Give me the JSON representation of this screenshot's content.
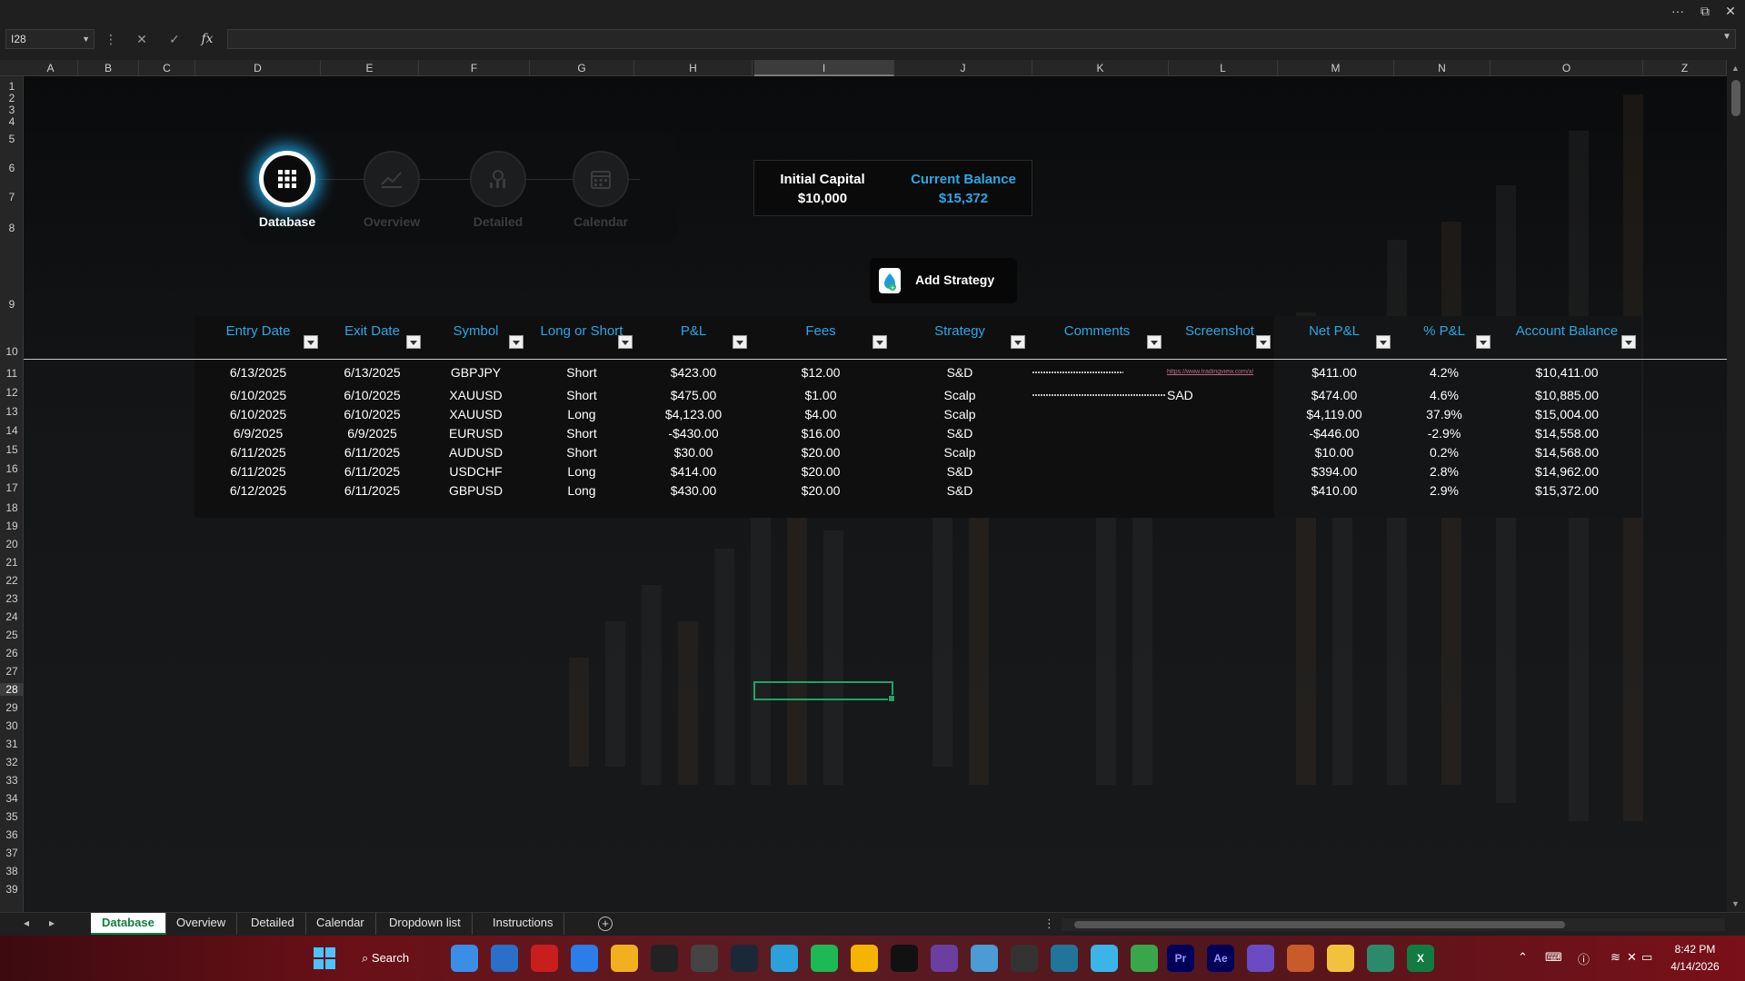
{
  "window": {
    "more": "···",
    "restore": "⧉",
    "close": "✕"
  },
  "formula_bar": {
    "name_box": "I28",
    "cancel": "✕",
    "enter": "✓",
    "fx": "fx",
    "more": "⋮"
  },
  "columns": [
    "A",
    "B",
    "C",
    "D",
    "E",
    "F",
    "G",
    "H",
    "I",
    "J",
    "K",
    "L",
    "M",
    "N",
    "O",
    "Z"
  ],
  "rows": [
    "1",
    "2",
    "3",
    "4",
    "5",
    "6",
    "7",
    "8",
    "9",
    "10",
    "11",
    "12",
    "13",
    "14",
    "15",
    "16",
    "17",
    "18",
    "19",
    "20",
    "21",
    "22",
    "23",
    "24",
    "25",
    "26",
    "27",
    "28",
    "29",
    "30",
    "31",
    "32",
    "33",
    "34",
    "35",
    "36",
    "37",
    "38",
    "39"
  ],
  "nav": [
    {
      "label": "Database",
      "icon": "grid-icon"
    },
    {
      "label": "Overview",
      "icon": "chart-icon"
    },
    {
      "label": "Detailed",
      "icon": "detail-chart-icon"
    },
    {
      "label": "Calendar",
      "icon": "calendar-icon"
    }
  ],
  "capital": {
    "initial_label": "Initial Capital",
    "initial_value": "$10,000",
    "current_label": "Current Balance",
    "current_value": "$15,372"
  },
  "add_strategy": {
    "label": "Add Strategy"
  },
  "table": {
    "headers": [
      "Entry Date",
      "Exit Date",
      "Symbol",
      "Long or Short",
      "P&L",
      "Fees",
      "Strategy",
      "Comments",
      "Screenshot",
      "Net P&L",
      "% P&L",
      "Account Balance"
    ],
    "rows": [
      [
        "6/13/2025",
        "6/13/2025",
        "GBPJPY",
        "Short",
        "$423.00",
        "$12.00",
        "S&D",
        "",
        "https://www.tradingview.com/x/",
        "$411.00",
        "4.2%",
        "$10,411.00"
      ],
      [
        "6/10/2025",
        "6/10/2025",
        "XAUUSD",
        "Short",
        "$475.00",
        "$1.00",
        "Scalp",
        "",
        "SAD",
        "$474.00",
        "4.6%",
        "$10,885.00"
      ],
      [
        "6/10/2025",
        "6/10/2025",
        "XAUUSD",
        "Long",
        "$4,123.00",
        "$4.00",
        "Scalp",
        "",
        "",
        "$4,119.00",
        "37.9%",
        "$15,004.00"
      ],
      [
        "6/9/2025",
        "6/9/2025",
        "EURUSD",
        "Short",
        "-$430.00",
        "$16.00",
        "S&D",
        "",
        "",
        "-$446.00",
        "-2.9%",
        "$14,558.00"
      ],
      [
        "6/11/2025",
        "6/11/2025",
        "AUDUSD",
        "Short",
        "$30.00",
        "$20.00",
        "Scalp",
        "",
        "",
        "$10.00",
        "0.2%",
        "$14,568.00"
      ],
      [
        "6/11/2025",
        "6/11/2025",
        "USDCHF",
        "Long",
        "$414.00",
        "$20.00",
        "S&D",
        "",
        "",
        "$394.00",
        "2.8%",
        "$14,962.00"
      ],
      [
        "6/12/2025",
        "6/11/2025",
        "GBPUSD",
        "Long",
        "$430.00",
        "$20.00",
        "S&D",
        "",
        "",
        "$410.00",
        "2.9%",
        "$15,372.00"
      ]
    ]
  },
  "sheet_tabs": [
    "Database",
    "Overview",
    "Detailed",
    "Calendar",
    "Dropdown list",
    "Instructions"
  ],
  "active_tab": "Database",
  "taskbar": {
    "search_label": "Search",
    "time": "8:42 PM",
    "date": "4/14/2026",
    "apps": [
      "Pr",
      "Ae",
      "X"
    ]
  },
  "colors": {
    "accent": "#29a8e6",
    "excel_green": "#107c41",
    "selection": "#21a366"
  }
}
